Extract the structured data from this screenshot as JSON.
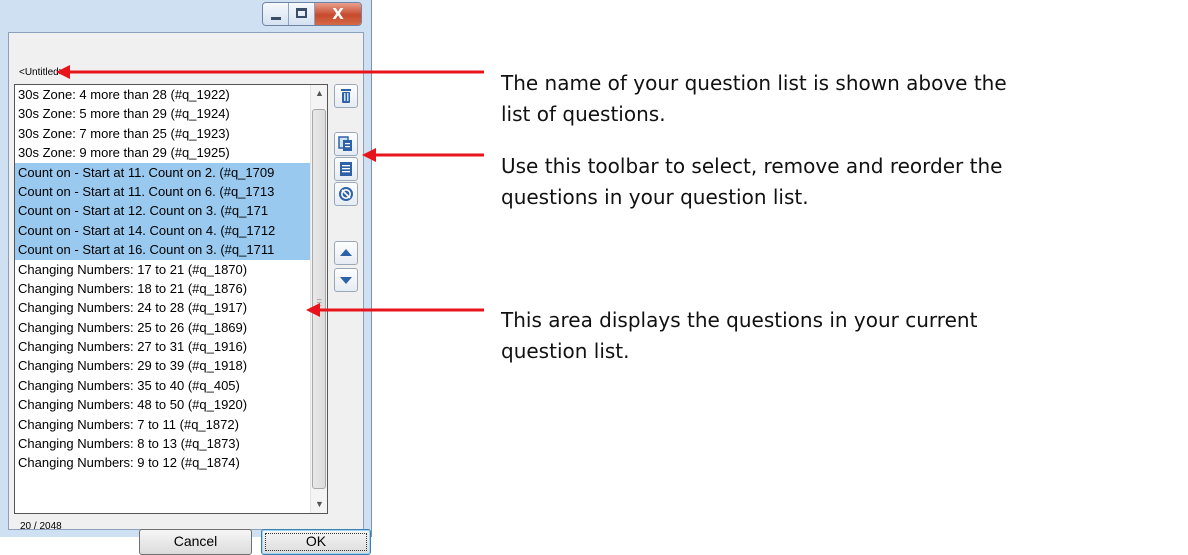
{
  "window": {
    "close_glyph": "X",
    "list_title": "<Untitled>",
    "count": "20 / 2048",
    "cancel_label": "Cancel",
    "ok_label": "OK"
  },
  "questions": [
    {
      "text": "30s Zone: 4 more than 28 (#q_1922)",
      "selected": false
    },
    {
      "text": "30s Zone: 5 more than 29 (#q_1924)",
      "selected": false
    },
    {
      "text": "30s Zone: 7 more than 25 (#q_1923)",
      "selected": false
    },
    {
      "text": "30s Zone: 9 more than 29 (#q_1925)",
      "selected": false
    },
    {
      "text": "Count on - Start at 11. Count on 2. (#q_1709",
      "selected": true
    },
    {
      "text": "Count on - Start at 11. Count on 6. (#q_1713",
      "selected": true
    },
    {
      "text": "Count on - Start at 12. Count on 3.  (#q_171",
      "selected": true
    },
    {
      "text": "Count on - Start at 14. Count on 4. (#q_1712",
      "selected": true
    },
    {
      "text": "Count on - Start at 16. Count on 3. (#q_1711",
      "selected": true
    },
    {
      "text": "Changing Numbers: 17 to 21 (#q_1870)",
      "selected": false
    },
    {
      "text": "Changing Numbers: 18 to 21 (#q_1876)",
      "selected": false
    },
    {
      "text": "Changing Numbers: 24 to 28 (#q_1917)",
      "selected": false
    },
    {
      "text": "Changing Numbers: 25 to 26 (#q_1869)",
      "selected": false
    },
    {
      "text": "Changing Numbers: 27 to 31 (#q_1916)",
      "selected": false
    },
    {
      "text": "Changing Numbers: 29 to 39 (#q_1918)",
      "selected": false
    },
    {
      "text": "Changing Numbers: 35  to 40 (#q_405)",
      "selected": false
    },
    {
      "text": "Changing Numbers: 48 to 50 (#q_1920)",
      "selected": false
    },
    {
      "text": "Changing Numbers: 7 to 11 (#q_1872)",
      "selected": false
    },
    {
      "text": "Changing Numbers: 8 to 13 (#q_1873)",
      "selected": false
    },
    {
      "text": "Changing Numbers: 9 to 12 (#q_1874)",
      "selected": false
    }
  ],
  "toolbar": {
    "icons": [
      "trash-icon",
      "copy-icon",
      "paste-icon",
      "deselect-icon",
      "move-up-icon",
      "move-down-icon"
    ]
  },
  "annotations": {
    "color": "#e8141c",
    "note1": [
      "The name of your question list is shown above the",
      "list of questions."
    ],
    "note2": [
      "Use this toolbar to select, remove and reorder the",
      "questions in your question list."
    ],
    "note3": [
      "This area displays the questions in your current",
      "question list."
    ]
  },
  "colors": {
    "selection": "#99c9ef",
    "window_frame": "#cfe0f2"
  }
}
